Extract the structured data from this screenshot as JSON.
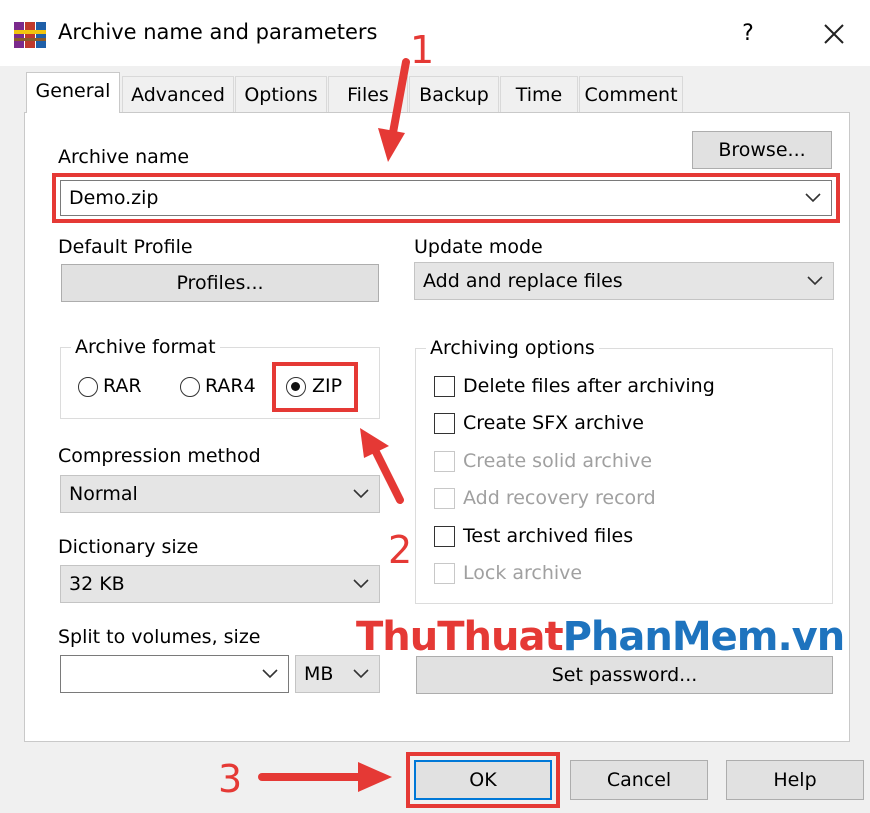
{
  "window": {
    "title": "Archive name and parameters",
    "help_label": "?"
  },
  "tabs": [
    {
      "label": "General",
      "active": true
    },
    {
      "label": "Advanced"
    },
    {
      "label": "Options"
    },
    {
      "label": "Files"
    },
    {
      "label": "Backup"
    },
    {
      "label": "Time"
    },
    {
      "label": "Comment"
    }
  ],
  "general": {
    "archive_name_label": "Archive name",
    "browse_label": "Browse...",
    "archive_name_value": "Demo.zip",
    "default_profile_label": "Default Profile",
    "profiles_label": "Profiles...",
    "update_mode_label": "Update mode",
    "update_mode_value": "Add and replace files",
    "archive_format": {
      "title": "Archive format",
      "options": [
        "RAR",
        "RAR4",
        "ZIP"
      ],
      "selected": "ZIP"
    },
    "compression_method_label": "Compression method",
    "compression_method_value": "Normal",
    "dictionary_size_label": "Dictionary size",
    "dictionary_size_value": "32 KB",
    "split_label": "Split to volumes, size",
    "split_value": "",
    "split_unit": "MB",
    "archiving_options": {
      "title": "Archiving options",
      "items": [
        {
          "label": "Delete files after archiving",
          "checked": false,
          "enabled": true
        },
        {
          "label": "Create SFX archive",
          "checked": false,
          "enabled": true
        },
        {
          "label": "Create solid archive",
          "checked": false,
          "enabled": false
        },
        {
          "label": "Add recovery record",
          "checked": false,
          "enabled": false
        },
        {
          "label": "Test archived files",
          "checked": false,
          "enabled": true
        },
        {
          "label": "Lock archive",
          "checked": false,
          "enabled": false
        }
      ]
    },
    "set_password_label": "Set password..."
  },
  "footer": {
    "ok_label": "OK",
    "cancel_label": "Cancel",
    "help_label": "Help"
  },
  "annotations": {
    "step1": "1",
    "step2": "2",
    "step3": "3",
    "color": "#e53935"
  },
  "watermark": {
    "part1": "ThuThuat",
    "part2": "PhanMem",
    "part3": ".vn",
    "color1": "#e53935",
    "color2": "#1e73be"
  }
}
